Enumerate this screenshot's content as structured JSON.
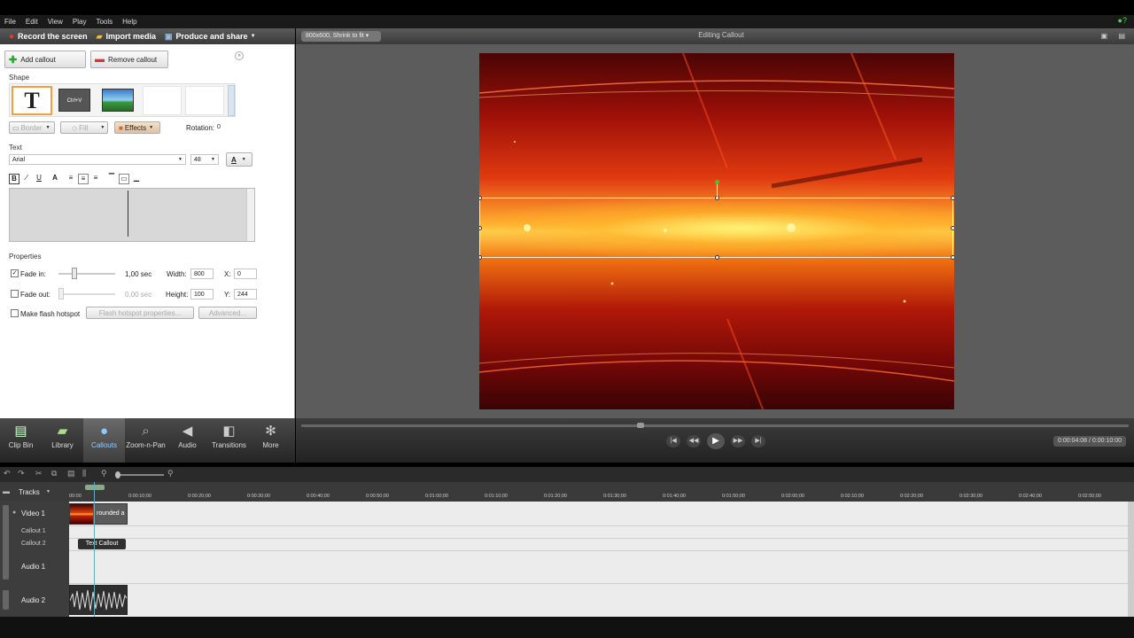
{
  "menu": [
    "File",
    "Edit",
    "View",
    "Play",
    "Tools",
    "Help"
  ],
  "toolbar": {
    "record": "Record the screen",
    "import": "Import media",
    "produce": "Produce and share"
  },
  "preview": {
    "size_select": "800x600, Shrink to fit",
    "title": "Editing Callout",
    "time": "0:00:04:08 / 0:00:10:00"
  },
  "callout": {
    "add": "Add callout",
    "remove": "Remove callout",
    "shape_label": "Shape",
    "shape_t": "T",
    "shape_ctrlv": "Ctrl+V",
    "border": "Border",
    "fill": "Fill",
    "effects": "Effects",
    "rotation_label": "Rotation:",
    "rotation": "0",
    "text_label": "Text",
    "font": "Arial",
    "font_size": "48",
    "bold": "B",
    "italic": "I",
    "underline": "U",
    "fontcolor": "A"
  },
  "properties": {
    "label": "Properties",
    "fade_in": "Fade in:",
    "fade_in_val": "1,00 sec",
    "fade_in_level": 0.25,
    "fade_out": "Fade out:",
    "fade_out_val": "0,00 sec",
    "fade_out_level": 0,
    "width_label": "Width:",
    "width": "800",
    "height_label": "Height:",
    "height": "100",
    "x_label": "X:",
    "x": "0",
    "y_label": "Y:",
    "y": "244",
    "flash": "Make flash hotspot",
    "flash_props": "Flash hotspot properties...",
    "advanced": "Advanced..."
  },
  "tabs": [
    "Clip Bin",
    "Library",
    "Callouts",
    "Zoom-n-Pan",
    "Audio",
    "Transitions",
    "More"
  ],
  "timeline": {
    "tracks_label": "Tracks",
    "ticks": [
      "00:00",
      "0:00:10;00",
      "0:00:20;00",
      "0:00:30;00",
      "0:00:40;00",
      "0:00:50;00",
      "0:01:00;00",
      "0:01:10;00",
      "0:01:20;00",
      "0:01:30;00",
      "0:01:40;00",
      "0:01:50;00",
      "0:02:00;00",
      "0:02:10;00",
      "0:02:20;00",
      "0:02:30;00",
      "0:02:40;00",
      "0:02:50;00"
    ],
    "video1": "Video 1",
    "callout1": "Callout 1",
    "callout2": "Callout 2",
    "audio1": "Audio 1",
    "audio2": "Audio 2",
    "clip_video": "rounded a",
    "clip_callout": "Text Callout"
  },
  "playhead_progress": 0.41
}
